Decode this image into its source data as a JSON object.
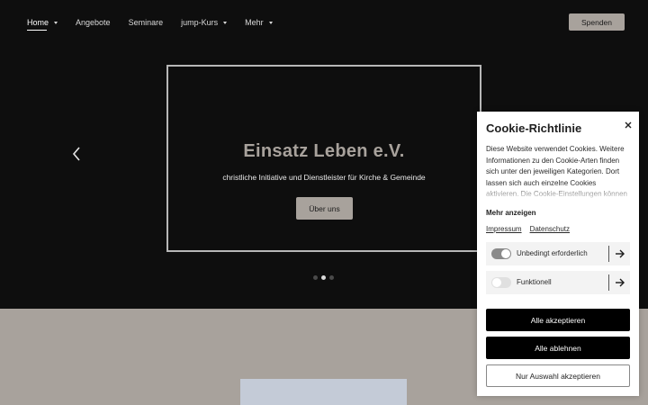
{
  "nav": {
    "items": [
      {
        "label": "Home",
        "has_caret": true
      },
      {
        "label": "Angebote",
        "has_caret": false
      },
      {
        "label": "Seminare",
        "has_caret": false
      },
      {
        "label": "jump-Kurs",
        "has_caret": true
      },
      {
        "label": "Mehr",
        "has_caret": true
      }
    ],
    "donate_label": "Spenden"
  },
  "slider": {
    "title": "Einsatz Leben e.V.",
    "subtitle": "christliche Initiative und Dienstleister für Kirche & Gemeinde",
    "button_label": "Über uns",
    "prev_icon": "chevron-left-icon",
    "active_dot": 2,
    "dot_count": 3
  },
  "cookie": {
    "title": "Cookie-Richtlinie",
    "close_icon": "close-icon",
    "text": "Diese Website verwendet Cookies. Weitere Informationen zu den Cookie-Arten finden sich unter den jeweiligen Kategorien. Dort lassen sich auch einzelne Cookies aktivieren. Die Cookie-Einstellungen können jederzeit",
    "more_label": "Mehr anzeigen",
    "links": [
      "Impressum",
      "Datenschutz"
    ],
    "categories": [
      {
        "label": "Unbedingt erforderlich",
        "enabled": true
      },
      {
        "label": "Funktionell",
        "enabled": false
      }
    ],
    "accept_all": "Alle akzeptieren",
    "reject_all": "Alle ablehnen",
    "accept_selection": "Nur Auswahl akzeptieren"
  },
  "colors": {
    "hero_bg": "#0e0e0e",
    "accent": "#a8a29c",
    "button_dark": "#000000"
  }
}
